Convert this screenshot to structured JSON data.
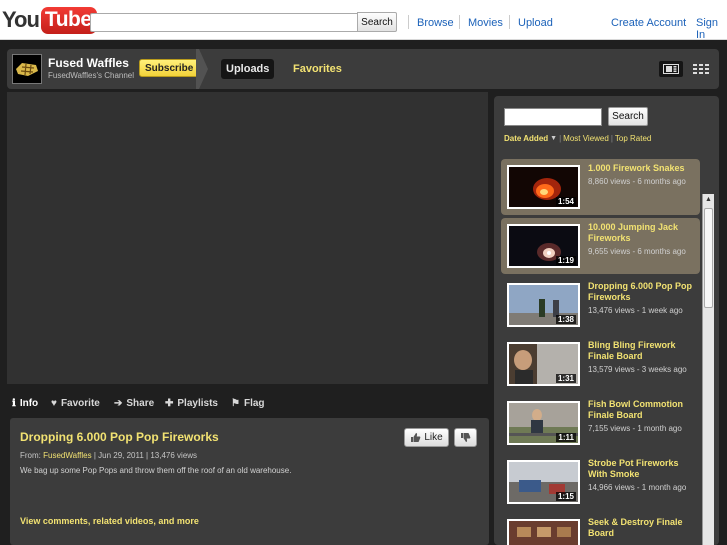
{
  "masthead": {
    "logo_you": "You",
    "logo_tube": "Tube",
    "search_value": "",
    "search_button": "Search",
    "nav": {
      "browse": "Browse",
      "movies": "Movies",
      "upload": "Upload",
      "create_account": "Create Account",
      "sign_in": "Sign In"
    }
  },
  "channel": {
    "name": "Fused Waffles",
    "subtitle": "FusedWaffles's Channel",
    "subscribe_label": "Subscribe",
    "tabs": {
      "uploads": "Uploads",
      "favorites": "Favorites"
    },
    "icons": [
      "player-view-icon",
      "grid-view-icon"
    ]
  },
  "actions": {
    "info": "Info",
    "favorite": "Favorite",
    "share": "Share",
    "playlists": "Playlists",
    "flag": "Flag"
  },
  "video_info": {
    "title": "Dropping 6.000 Pop Pop Fireworks",
    "from_label": "From:",
    "author": "FusedWaffles",
    "date": "Jun 29, 2011",
    "views": "13,476 views",
    "description": "We bag up some Pop Pops and throw them off the roof of an old warehouse.",
    "more_link": "View comments, related videos, and more",
    "like_label": "Like"
  },
  "sidebar": {
    "search_value": "",
    "search_button": "Search",
    "sort": {
      "date_added": "Date Added",
      "most_viewed": "Most Viewed",
      "top_rated": "Top Rated"
    },
    "videos": [
      {
        "title": "1.000 Firework Snakes",
        "meta": "8,860 views - 6 months ago",
        "duration": "1:54",
        "highlighted": true
      },
      {
        "title": "10.000 Jumping Jack Fireworks",
        "meta": "9,655 views - 6 months ago",
        "duration": "1:19",
        "highlighted": true
      },
      {
        "title": "Dropping 6.000 Pop Pop Fireworks",
        "meta": "13,476 views - 1 week ago",
        "duration": "1:38",
        "highlighted": false
      },
      {
        "title": "Bling Bling Firework Finale Board",
        "meta": "13,579 views - 3 weeks ago",
        "duration": "1:31",
        "highlighted": false
      },
      {
        "title": "Fish Bowl Commotion Finale Board",
        "meta": "7,155 views - 1 month ago",
        "duration": "1:11",
        "highlighted": false
      },
      {
        "title": "Strobe Pot Fireworks With Smoke",
        "meta": "14,966 views - 1 month ago",
        "duration": "1:15",
        "highlighted": false
      },
      {
        "title": "Seek & Destroy Finale Board",
        "meta": "",
        "duration": "",
        "highlighted": false
      }
    ]
  },
  "colors": {
    "accent_yellow": "#f2e272",
    "link_blue": "#1c62b9",
    "panel": "#3c3c3c",
    "background": "#1f1f1f",
    "highlight": "#7a7160"
  }
}
